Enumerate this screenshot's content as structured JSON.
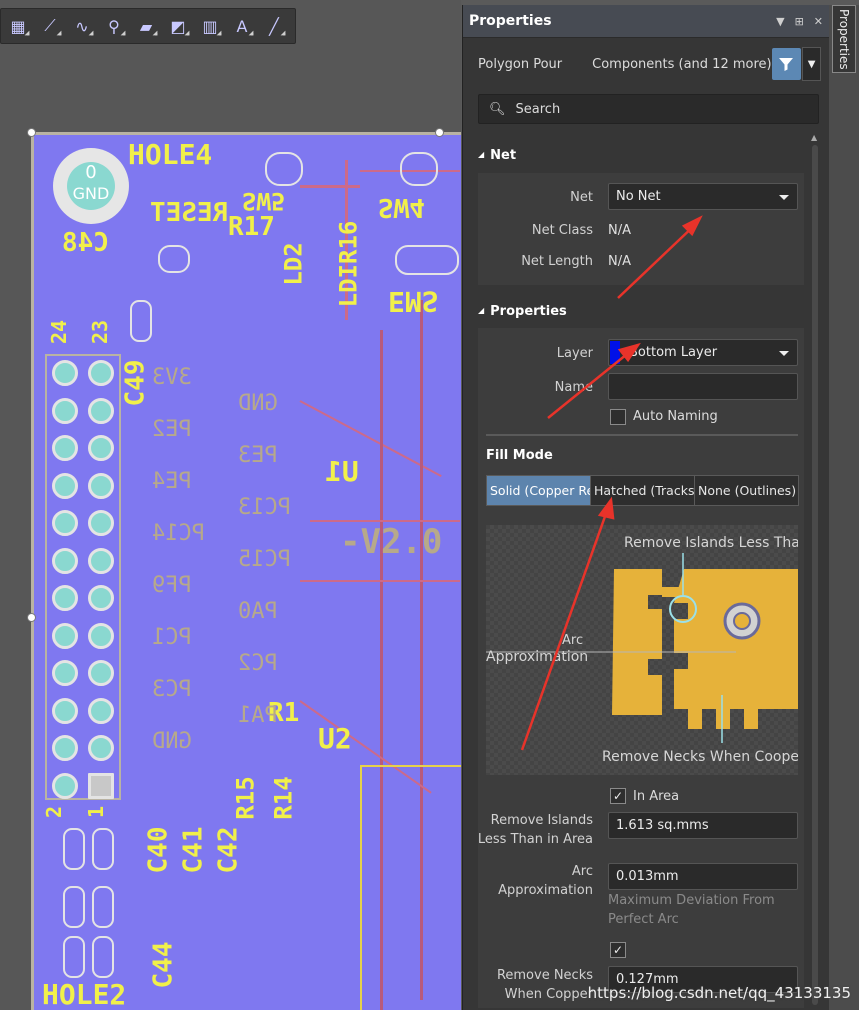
{
  "toolbar": {
    "tools": [
      {
        "icon": "select-component-icon",
        "glyph": "▦"
      },
      {
        "icon": "route-track-icon",
        "glyph": "⟋"
      },
      {
        "icon": "interactive-routing-icon",
        "glyph": "∿"
      },
      {
        "icon": "place-via-icon",
        "glyph": "⚲"
      },
      {
        "icon": "place-fill-icon",
        "glyph": "▰"
      },
      {
        "icon": "polygon-pour-icon",
        "glyph": "◩"
      },
      {
        "icon": "place-dimension-icon",
        "glyph": "▥"
      },
      {
        "icon": "place-string-icon",
        "glyph": "A"
      },
      {
        "icon": "place-line-icon",
        "glyph": "╱"
      }
    ]
  },
  "pcb": {
    "hole4": "HOLE4",
    "hole2": "HOLE2",
    "gnd_top": "0",
    "gnd_bottom": "GND",
    "reset": "RESET",
    "c48": "C48",
    "r17": "R17",
    "sw5": "SW5",
    "sw4": "SW4",
    "ems": "EMS",
    "ld2": "LD2",
    "ldir16": "LDIR16",
    "c49": "C49",
    "u1": "U1",
    "u2": "U2",
    "r1": "R1",
    "r15": "R15",
    "r14": "R14",
    "c40": "C40",
    "c41": "C41",
    "c42": "C42",
    "c44": "C44",
    "pin24": "24",
    "pin23": "23",
    "pin2": "2",
    "pin1": "1",
    "v20": "-V2.0",
    "mirrored_labels": [
      "3V3",
      "GND",
      "PE2",
      "PE3",
      "PE4",
      "PC13",
      "PC14",
      "PC15",
      "PF9",
      "PA0",
      "PC1",
      "PC2",
      "PC3",
      "PA1",
      "GND"
    ]
  },
  "panel": {
    "title": "Properties",
    "filter_object": "Polygon Pour",
    "filter_scope": "Components (and 12 more)",
    "search_placeholder": "Search",
    "net_section": {
      "header": "Net",
      "net_label": "Net",
      "net_value": "No Net",
      "net_class_label": "Net Class",
      "net_class_value": "N/A",
      "net_length_label": "Net Length",
      "net_length_value": "N/A"
    },
    "properties_section": {
      "header": "Properties",
      "layer_label": "Layer",
      "layer_value": "Bottom Layer",
      "layer_color": "#0010e8",
      "name_label": "Name",
      "name_value": "",
      "auto_naming_label": "Auto Naming",
      "auto_naming_checked": false
    },
    "fill_mode": {
      "header": "Fill Mode",
      "tabs": [
        "Solid (Copper Re",
        "Hatched (Tracks/",
        "None (Outlines)"
      ],
      "active_tab": 0
    },
    "diagram": {
      "remove_islands_caption": "Remove Islands Less Than",
      "arc_caption": "Arc",
      "approximation_caption": "Approximation",
      "remove_necks_caption": "Remove Necks When Cooper",
      "copper_color": "#e6b23a"
    },
    "islands": {
      "in_area_checked": true,
      "in_area_label": "In Area",
      "label_line1": "Remove Islands",
      "label_line2": "Less Than in Area",
      "value": "1.613 sq.mms"
    },
    "arc": {
      "label_line1": "Arc",
      "label_line2": "Approximation",
      "value": "0.013mm",
      "hint_line1": "Maximum Deviation From",
      "hint_line2": "Perfect Arc"
    },
    "necks": {
      "checked": true,
      "label_line1": "Remove Necks",
      "label_line2": "When Copper",
      "value": "0.127mm"
    }
  },
  "side_tab": {
    "label": "Properties"
  },
  "watermark": "https://blog.csdn.net/qq_43133135"
}
